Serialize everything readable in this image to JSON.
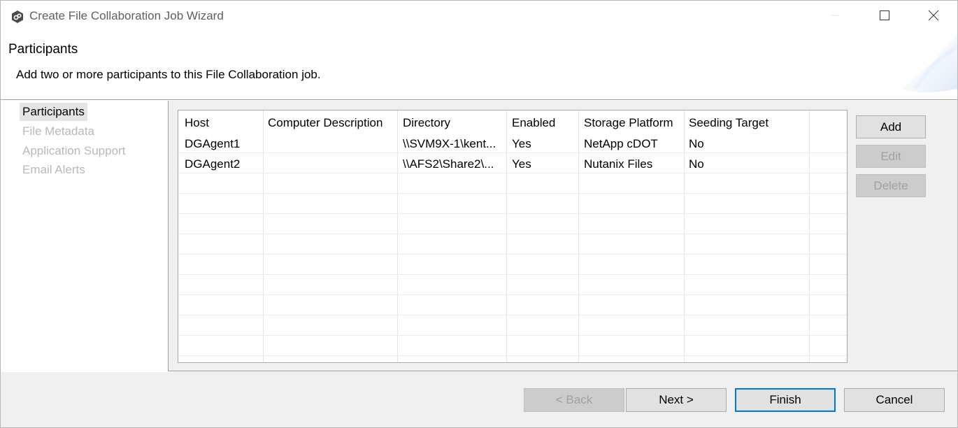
{
  "window": {
    "title": "Create File Collaboration Job Wizard",
    "icon": "peer-app-icon",
    "controls": [
      "minimize-icon",
      "maximize-icon",
      "close-icon"
    ]
  },
  "header": {
    "title": "Participants",
    "description": "Add two or more participants to this File Collaboration job."
  },
  "nav": {
    "items": [
      {
        "label": "Participants",
        "state": "active"
      },
      {
        "label": "File Metadata",
        "state": "disabled"
      },
      {
        "label": "Application Support",
        "state": "disabled"
      },
      {
        "label": "Email Alerts",
        "state": "disabled"
      }
    ]
  },
  "table": {
    "columns": [
      "Host",
      "Computer Description",
      "Directory",
      "Enabled",
      "Storage Platform",
      "Seeding Target"
    ],
    "rows": [
      [
        "DGAgent1",
        "",
        "\\\\SVM9X-1\\kent...",
        "Yes",
        "NetApp cDOT",
        "No"
      ],
      [
        "DGAgent2",
        "",
        "\\\\AFS2\\Share2\\...",
        "Yes",
        "Nutanix Files",
        "No"
      ]
    ]
  },
  "side_buttons": {
    "add": "Add",
    "edit": "Edit",
    "delete": "Delete"
  },
  "footer": {
    "back": "< Back",
    "next": "Next >",
    "finish": "Finish",
    "cancel": "Cancel"
  },
  "colors": {
    "accent": "#0078d7",
    "window_bg": "#f0f0f0",
    "disabled_text": "#b9b9b9"
  }
}
